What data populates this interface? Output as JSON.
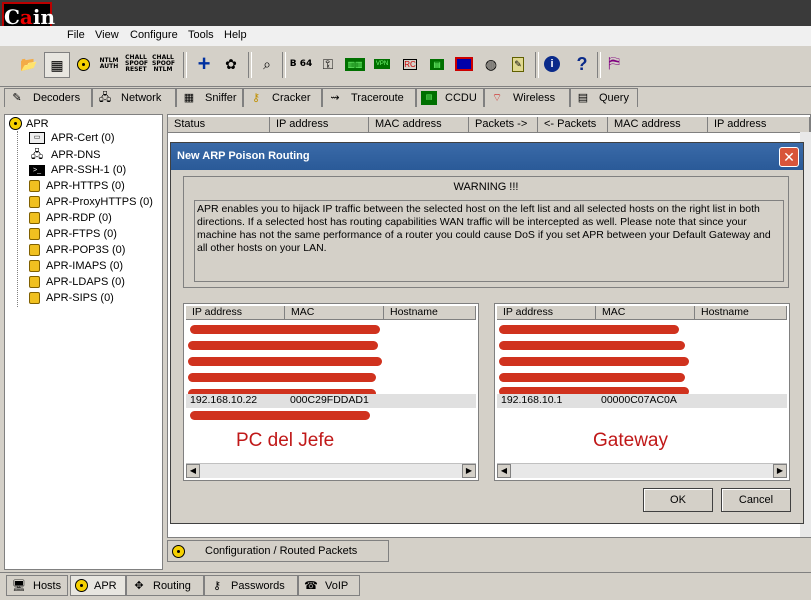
{
  "menu": [
    "File",
    "View",
    "Configure",
    "Tools",
    "Help"
  ],
  "toolbar_icons": [
    "open-icon",
    "sniffer-icon",
    "radiation-icon",
    "ntlm-auth-icon",
    "chall-spoof-reset-icon",
    "chall-spoof-ntlm-icon",
    "add-icon",
    "wizard-icon",
    "search-icon",
    "base64-icon",
    "key-icon",
    "network-icon",
    "vpn-icon",
    "rdp-icon",
    "terminal-icon",
    "cert-icon",
    "info-icon",
    "help-icon",
    "route-icon"
  ],
  "toolbar_texts": {
    "ntlm": "NTLM AUTH",
    "reset": "CHALL SPOOF RESET",
    "chall": "CHALL SPOOF NTLM",
    "b64": "B 64"
  },
  "tabs": [
    "Decoders",
    "Network",
    "Sniffer",
    "Cracker",
    "Traceroute",
    "CCDU",
    "Wireless",
    "Query"
  ],
  "tree": {
    "root": "APR",
    "items": [
      "APR-Cert (0)",
      "APR-DNS",
      "APR-SSH-1 (0)",
      "APR-HTTPS (0)",
      "APR-ProxyHTTPS (0)",
      "APR-RDP (0)",
      "APR-FTPS (0)",
      "APR-POP3S (0)",
      "APR-IMAPS (0)",
      "APR-LDAPS (0)",
      "APR-SIPS (0)"
    ]
  },
  "list_headers": [
    "Status",
    "IP address",
    "MAC address",
    "Packets ->",
    "<- Packets",
    "MAC address",
    "IP address"
  ],
  "dialog": {
    "title": "New ARP Poison Routing",
    "warning_title": "WARNING !!!",
    "warning_text": "APR enables you to hijack IP traffic between the selected host on the left list and all selected hosts on the right list in both directions. If a selected host has routing capabilities WAN traffic will be intercepted as well. Please note that since your machine has not the same performance of a router you could cause DoS if you set APR between your Default Gateway and all other hosts on your LAN.",
    "columns": [
      "IP address",
      "MAC",
      "Hostname"
    ],
    "left": {
      "selected_ip": "192.168.10.22",
      "selected_mac": "000C29FDDAD1",
      "annotation": "PC del Jefe"
    },
    "right": {
      "selected_ip": "192.168.10.1",
      "selected_mac": "00000C07AC0A",
      "annotation": "Gateway"
    },
    "ok_label": "OK",
    "cancel_label": "Cancel"
  },
  "bottom_tab": "Configuration / Routed Packets",
  "bottom_bar": [
    "Hosts",
    "APR",
    "Routing",
    "Passwords",
    "VoIP"
  ],
  "colors": {
    "redaction": "#d0321e",
    "annotation": "#c01818",
    "title_bar": "#2a5a98"
  }
}
